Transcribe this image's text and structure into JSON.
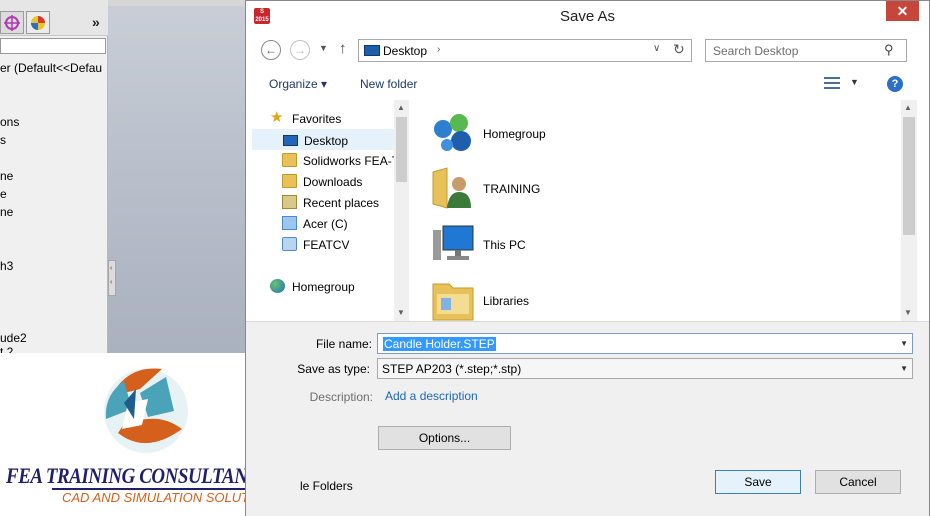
{
  "background_app": {
    "tree_lines": [
      "er  (Default<<Defau",
      "ons",
      "s",
      "ne",
      "e",
      "ne",
      "h3",
      "ude2",
      "t 2"
    ]
  },
  "logo": {
    "title": "FEA TRAINING  CONSULTANTS INC.",
    "subtitle": "CAD AND SIMULATION SOLUTIONS",
    "colors": {
      "navy": "#1f1f6b",
      "orange": "#d5601b",
      "teal": "#4aa3b8"
    }
  },
  "dialog": {
    "title": "Save As",
    "app_icon_text": "S 2015",
    "close_glyph": "✕",
    "address": {
      "location": "Desktop",
      "separator": "›"
    },
    "search": {
      "placeholder": "Search Desktop"
    },
    "toolbar": {
      "organize": "Organize ▾",
      "new_folder": "New folder",
      "help": "?"
    },
    "nav_pane": {
      "favorites": "Favorites",
      "items": [
        {
          "label": "Desktop",
          "icon": "desktop-icon",
          "selected": true
        },
        {
          "label": "Solidworks FEA-T",
          "icon": "folder-icon"
        },
        {
          "label": "Downloads",
          "icon": "downloads-icon"
        },
        {
          "label": "Recent places",
          "icon": "recent-places-icon"
        },
        {
          "label": "Acer (C)",
          "icon": "drive-icon"
        },
        {
          "label": "FEATCV",
          "icon": "network-drive-icon"
        }
      ],
      "homegroup": "Homegroup"
    },
    "files": [
      {
        "label": "Homegroup",
        "icon": "homegroup-icon"
      },
      {
        "label": "TRAINING",
        "icon": "user-folder-icon"
      },
      {
        "label": "This PC",
        "icon": "computer-icon"
      },
      {
        "label": "Libraries",
        "icon": "libraries-icon"
      }
    ],
    "form": {
      "file_name_label": "File name:",
      "file_name_value": "Candle Holder.STEP",
      "save_type_label": "Save as type:",
      "save_type_value": "STEP AP203 (*.step;*.stp)",
      "description_label": "Description:",
      "add_description": "Add a description",
      "options": "Options...",
      "hide_folders": "le Folders"
    },
    "buttons": {
      "save": "Save",
      "cancel": "Cancel"
    }
  }
}
